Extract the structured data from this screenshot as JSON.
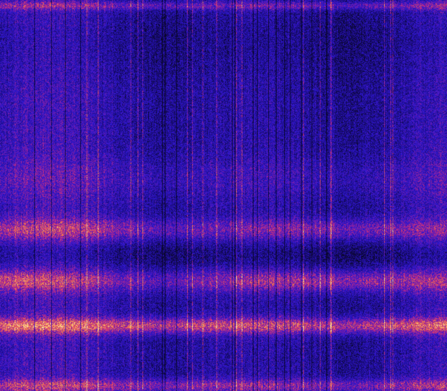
{
  "image": {
    "kind": "spectrogram",
    "colormap": "magma-like",
    "colors": {
      "background_low": "#0a0a3a",
      "base_blue": "#2a14c8",
      "mid_purple": "#7a1ca8",
      "magenta": "#d0347a",
      "orange": "#f08a3a",
      "highlight_yellow": "#fff0a0"
    },
    "features": {
      "vertical_streaks": true,
      "horizontal_energy_bands": 4,
      "bright_top_and_bottom_edges": true
    }
  }
}
